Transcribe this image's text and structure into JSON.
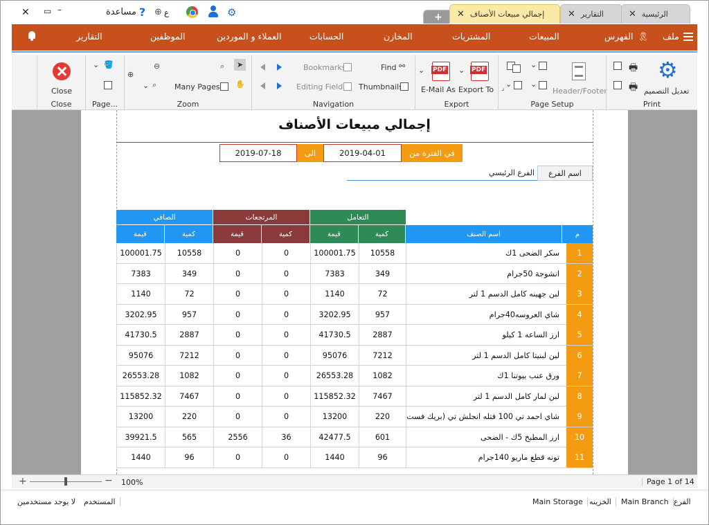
{
  "titlebar": {
    "help_label": "مساعدة",
    "lang_label": "ع",
    "tabs": [
      {
        "label": "الرئيسية",
        "active": false
      },
      {
        "label": "التقارير",
        "active": false
      },
      {
        "label": "إجمالي مبيعات الأصناف",
        "active": true
      }
    ],
    "add_tab": "+"
  },
  "menu": {
    "items": [
      "ملف",
      "الفهرس",
      "المبيعات",
      "المشتريات",
      "المخازن",
      "الحسابات",
      "العملاء و الموردين",
      "الموظفين",
      "التقارير"
    ]
  },
  "ribbon": {
    "print_group": {
      "caption": "Print",
      "customize": "تعديل التصميم"
    },
    "page_setup_group": {
      "caption": "Page Setup",
      "header_footer": "Header/Footer"
    },
    "export_group": {
      "caption": "Export",
      "email_as": "E-Mail As",
      "export_to": "Export To",
      "pdf_badge": "PDF"
    },
    "navigation_group": {
      "caption": "Navigation",
      "find": "Find",
      "thumbnails": "Thumbnails",
      "bookmarks": "Bookmarks",
      "editing_fields": "Editing Fields"
    },
    "zoom_group": {
      "caption": "Zoom",
      "many_pages": "Many Pages"
    },
    "page_group": {
      "caption": "Page..."
    },
    "close_group": {
      "caption": "Close",
      "close": "Close"
    }
  },
  "report": {
    "title": "إجمالي مبيعات الأصناف",
    "period_label": "في الفترة من",
    "from_date": "2019-04-01",
    "to_label": "الى",
    "to_date": "2019-07-18",
    "branch_label": "اسم الفرع",
    "branch_value": "الفرع الرئيسي",
    "groups": {
      "dealing": "التعامل",
      "returns": "المرتجعات",
      "net": "الصافي"
    },
    "columns": {
      "idx": "م",
      "name": "اسم الصنف",
      "qty": "كمية",
      "value": "قيمة"
    },
    "colors": {
      "orange": "#f39c12",
      "blue": "#2196f3",
      "green": "#2e8b57",
      "maroon": "#8b3a3a"
    },
    "rows": [
      {
        "idx": "1",
        "name": "سكر الضحى 1ك",
        "qty": "10558",
        "value": "100001.75",
        "rqty": "0",
        "rvalue": "0",
        "nqty": "10558",
        "nvalue": "100001.75"
      },
      {
        "idx": "2",
        "name": "انشوجة 50جرام",
        "qty": "349",
        "value": "7383",
        "rqty": "0",
        "rvalue": "0",
        "nqty": "349",
        "nvalue": "7383"
      },
      {
        "idx": "3",
        "name": "لبن جهينه كامل الدسم 1 لتر",
        "qty": "72",
        "value": "1140",
        "rqty": "0",
        "rvalue": "0",
        "nqty": "72",
        "nvalue": "1140"
      },
      {
        "idx": "4",
        "name": "شاي العروسه40جرام",
        "qty": "957",
        "value": "3202.95",
        "rqty": "0",
        "rvalue": "0",
        "nqty": "957",
        "nvalue": "3202.95"
      },
      {
        "idx": "5",
        "name": "ارز الساعه 1 كيلو",
        "qty": "2887",
        "value": "41730.5",
        "rqty": "0",
        "rvalue": "0",
        "nqty": "2887",
        "nvalue": "41730.5"
      },
      {
        "idx": "6",
        "name": "لبن لبنيتا كامل الدسم 1 لتر",
        "qty": "7212",
        "value": "95076",
        "rqty": "0",
        "rvalue": "0",
        "nqty": "7212",
        "nvalue": "95076"
      },
      {
        "idx": "7",
        "name": "ورق عنب بيوتنا 1ك",
        "qty": "1082",
        "value": "26553.28",
        "rqty": "0",
        "rvalue": "0",
        "nqty": "1082",
        "nvalue": "26553.28"
      },
      {
        "idx": "8",
        "name": "لبن لمار كامل الدسم 1 لتر",
        "qty": "7467",
        "value": "115852.32",
        "rqty": "0",
        "rvalue": "0",
        "nqty": "7467",
        "nvalue": "115852.32"
      },
      {
        "idx": "9",
        "name": "شاي احمد تي 100 فتله انجلش تي (بريك فست",
        "qty": "220",
        "value": "13200",
        "rqty": "0",
        "rvalue": "0",
        "nqty": "220",
        "nvalue": "13200"
      },
      {
        "idx": "10",
        "name": "ارز المطبخ 5ك - الضحى",
        "qty": "601",
        "value": "42477.5",
        "rqty": "36",
        "rvalue": "2556",
        "nqty": "565",
        "nvalue": "39921.5"
      },
      {
        "idx": "11",
        "name": "تونه قطع ماريو 140جرام",
        "qty": "96",
        "value": "1440",
        "rqty": "0",
        "rvalue": "0",
        "nqty": "96",
        "nvalue": "1440"
      }
    ]
  },
  "zoom": {
    "plus": "+",
    "minus": "−",
    "percent": "100%",
    "page_info": "Page 1 of 14",
    "level": 0.5
  },
  "status": {
    "branch_label": "الفرع",
    "branch_value": "Main Branch",
    "storage_label": "الخزينه",
    "storage_value": "Main Storage",
    "user_label": "المستخدم",
    "user_value": "لا يوجد مستخدمين"
  }
}
